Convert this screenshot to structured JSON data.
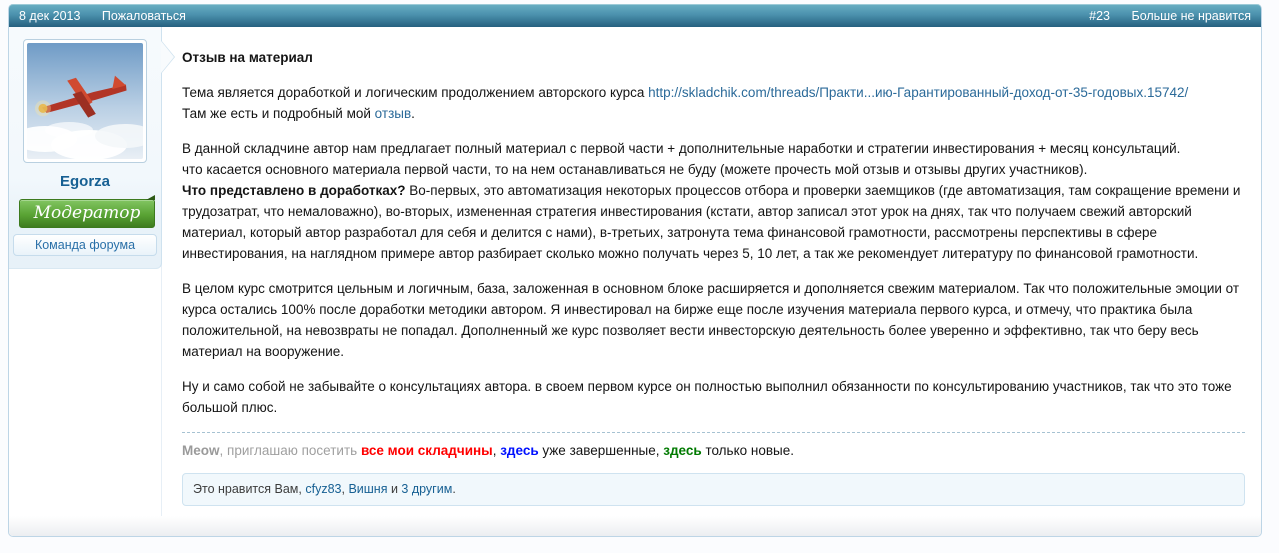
{
  "header": {
    "date": "8 дек 2013",
    "report_label": "Пожаловаться",
    "post_number": "#23",
    "unlike_label": "Больше не нравится"
  },
  "user": {
    "name": "Egorza",
    "banner": "Модератор",
    "title": "Команда форума",
    "avatar": "red-biplane-over-clouds"
  },
  "message": {
    "title": "Отзыв на материал",
    "p1": {
      "before_link": "Тема является доработкой и логическим продолжением авторского курса ",
      "url": "http://skladchik.com/threads/Практи...ию-Гарантированный-доход-от-35-годовых.15742/",
      "line2_before": "Там же есть и подробный мой ",
      "line2_link": "отзыв",
      "line2_after": "."
    },
    "p2": {
      "line1": "В данной складчине автор нам предлагает полный материал с первой части + дополнительные наработки и стратегии инвестирования + месяц консультаций.",
      "line2": "что касается основного материала первой части, то на нем останавливаться не буду (можете прочесть мой отзыв и отзывы других участников).",
      "bold": "Что представлено в доработках?",
      "rest": " Во-первых, это автоматизация некоторых процессов отбора и проверки заемщиков (где автоматизация, там сокращение времени и трудозатрат, что немаловажно), во-вторых, измененная стратегия инвестирования (кстати, автор записал этот урок на днях, так что получаем свежий авторский материал, который автор разработал для себя и делится с нами), в-третьих, затронута тема финансовой грамотности, рассмотрены перспективы в сфере инвестирования, на наглядном примере автор разбирает сколько можно получать через 5, 10 лет, а так же рекомендует литературу по финансовой грамотности."
    },
    "p3": "В целом курс смотрится цельным и логичным, база, заложенная в основном блоке расширяется и дополняется свежим материалом. Так что положительные эмоции от курса остались 100% после доработки методики автором. Я инвестировал на бирже еще после изучения материала первого курса, и отмечу, что практика была положительной, на невозвраты не попадал. Дополненный же курс позволяет вести инвесторскую деятельность более уверенно и эффективно, так что беру весь материал на вооружение.",
    "p4": "Ну и само собой не забывайте о консультациях автора. в своем первом курсе он полностью выполнил обязанности по консультированию участников, так что это тоже большой плюс."
  },
  "signature": {
    "author": "Meow",
    "after_author": ", приглашаю посетить ",
    "link_red": "все мои складчины",
    "sep1": ", ",
    "link_blue": "здесь",
    "mid": " уже завершенные, ",
    "link_green": "здесь",
    "tail": " только новые."
  },
  "likes": {
    "prefix": "Это нравится Вам, ",
    "user1": "cfyz83",
    "sep1": ", ",
    "user2": "Вишня",
    "sep2": " и ",
    "others": "3 другим",
    "suffix": "."
  },
  "colors": {
    "header_gradient_top": "#69afc3",
    "header_gradient_bottom": "#25607f",
    "link_blue": "#2b6a99",
    "username_blue": "#176093",
    "banner_green": "#59a334",
    "sig_red": "#ff0000",
    "sig_blue": "#0010ff",
    "sig_green": "#007a00",
    "sidebar_bg": "#e9f2f9",
    "like_box_bg": "#f1f8fc"
  }
}
